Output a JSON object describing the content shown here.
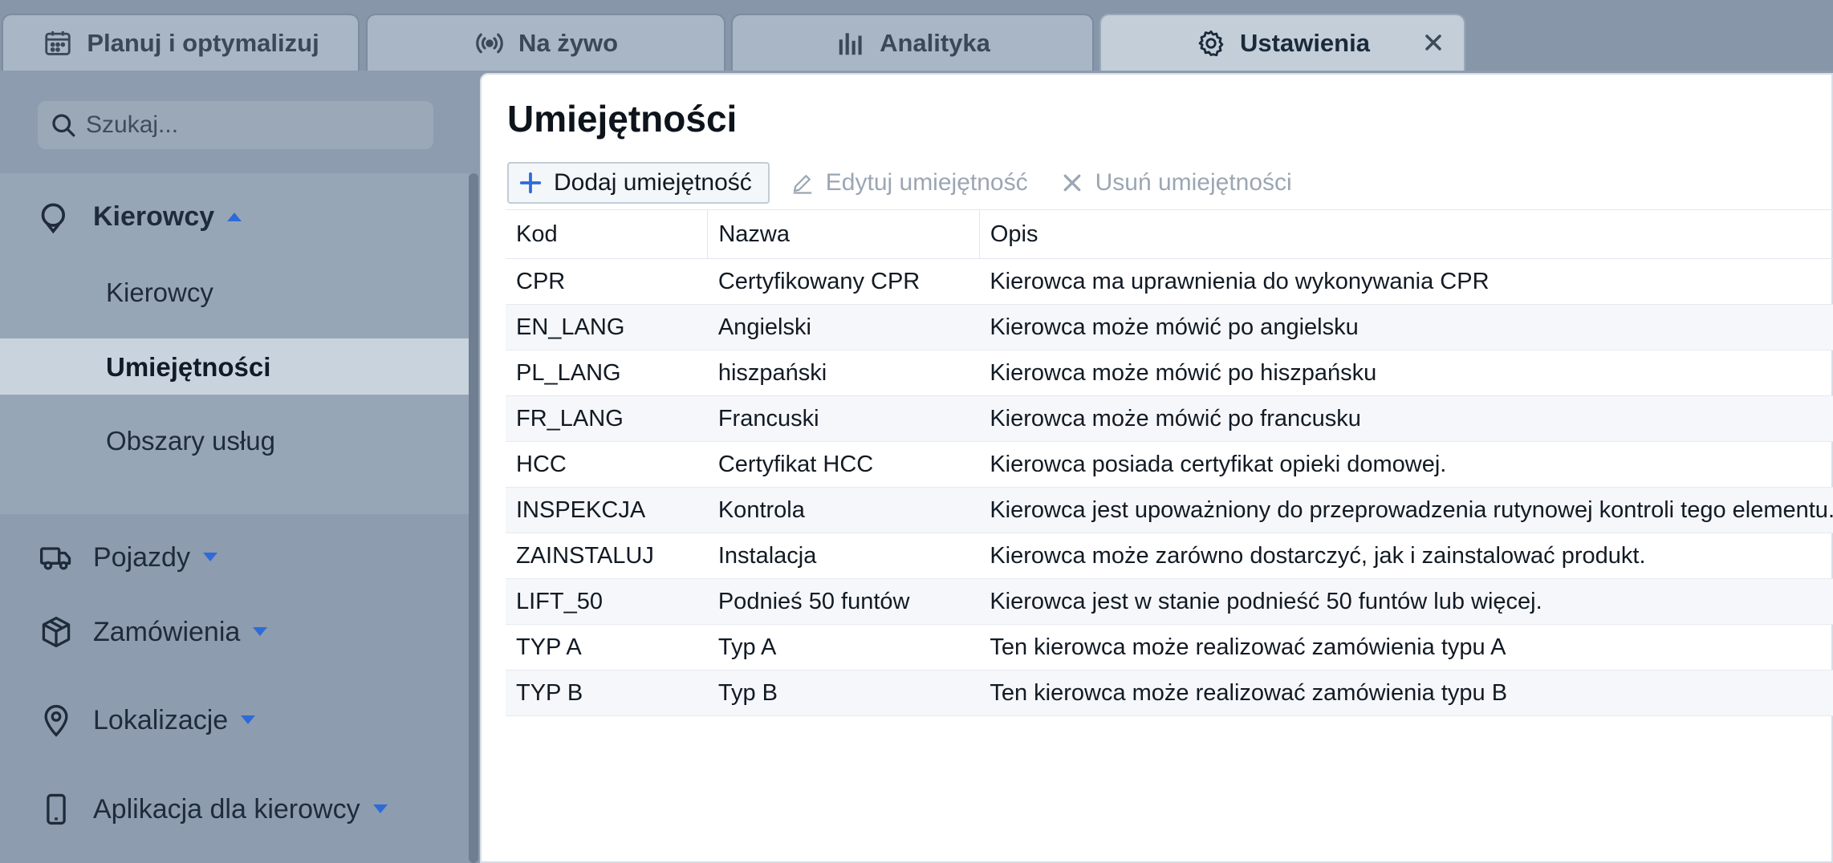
{
  "tabs": [
    {
      "label": "Planuj i optymalizuj",
      "icon": "calendar-icon"
    },
    {
      "label": "Na żywo",
      "icon": "broadcast-icon"
    },
    {
      "label": "Analityka",
      "icon": "bar-chart-icon"
    },
    {
      "label": "Ustawienia",
      "icon": "gear-icon",
      "active": true
    }
  ],
  "sidebar": {
    "search_placeholder": "Szukaj...",
    "drivers_group": {
      "label": "Kierowcy",
      "icon": "drivers-icon",
      "items": [
        {
          "label": "Kierowcy"
        },
        {
          "label": "Umiejętności",
          "active": true
        },
        {
          "label": "Obszary usług"
        }
      ]
    },
    "groups": [
      {
        "label": "Pojazdy",
        "icon": "truck-icon"
      },
      {
        "label": "Zamówienia",
        "icon": "box-icon"
      },
      {
        "label": "Lokalizacje",
        "icon": "map-pin-icon"
      },
      {
        "label": "Aplikacja dla kierowcy",
        "icon": "phone-icon"
      }
    ]
  },
  "main": {
    "title": "Umiejętności",
    "toolbar": {
      "add_label": "Dodaj umiejętność",
      "edit_label": "Edytuj umiejętność",
      "delete_label": "Usuń umiejętności"
    },
    "table": {
      "columns": [
        "Kod",
        "Nazwa",
        "Opis"
      ],
      "rows": [
        [
          "CPR",
          "Certyfikowany CPR",
          "Kierowca ma uprawnienia do wykonywania CPR"
        ],
        [
          "EN_LANG",
          "Angielski",
          "Kierowca może mówić po angielsku"
        ],
        [
          "PL_LANG",
          "hiszpański",
          "Kierowca może mówić po hiszpańsku"
        ],
        [
          "FR_LANG",
          "Francuski",
          "Kierowca może mówić po francusku"
        ],
        [
          "HCC",
          "Certyfikat HCC",
          "Kierowca posiada certyfikat opieki domowej."
        ],
        [
          "INSPEKCJA",
          "Kontrola",
          "Kierowca jest upoważniony do przeprowadzenia rutynowej kontroli tego elementu."
        ],
        [
          "ZAINSTALUJ",
          "Instalacja",
          "Kierowca może zarówno dostarczyć, jak i zainstalować produkt."
        ],
        [
          "LIFT_50",
          "Podnieś 50 funtów",
          "Kierowca jest w stanie podnieść 50 funtów lub więcej."
        ],
        [
          "TYP A",
          "Typ A",
          "Ten kierowca może realizować zamówienia typu A"
        ],
        [
          "TYP B",
          "Typ B",
          "Ten kierowca może realizować zamówienia typu B"
        ]
      ]
    }
  },
  "colors": {
    "accent": "#2f6bd8",
    "sidebar_bg": "#8d9cae",
    "active_item_bg": "#c9d3dd"
  }
}
